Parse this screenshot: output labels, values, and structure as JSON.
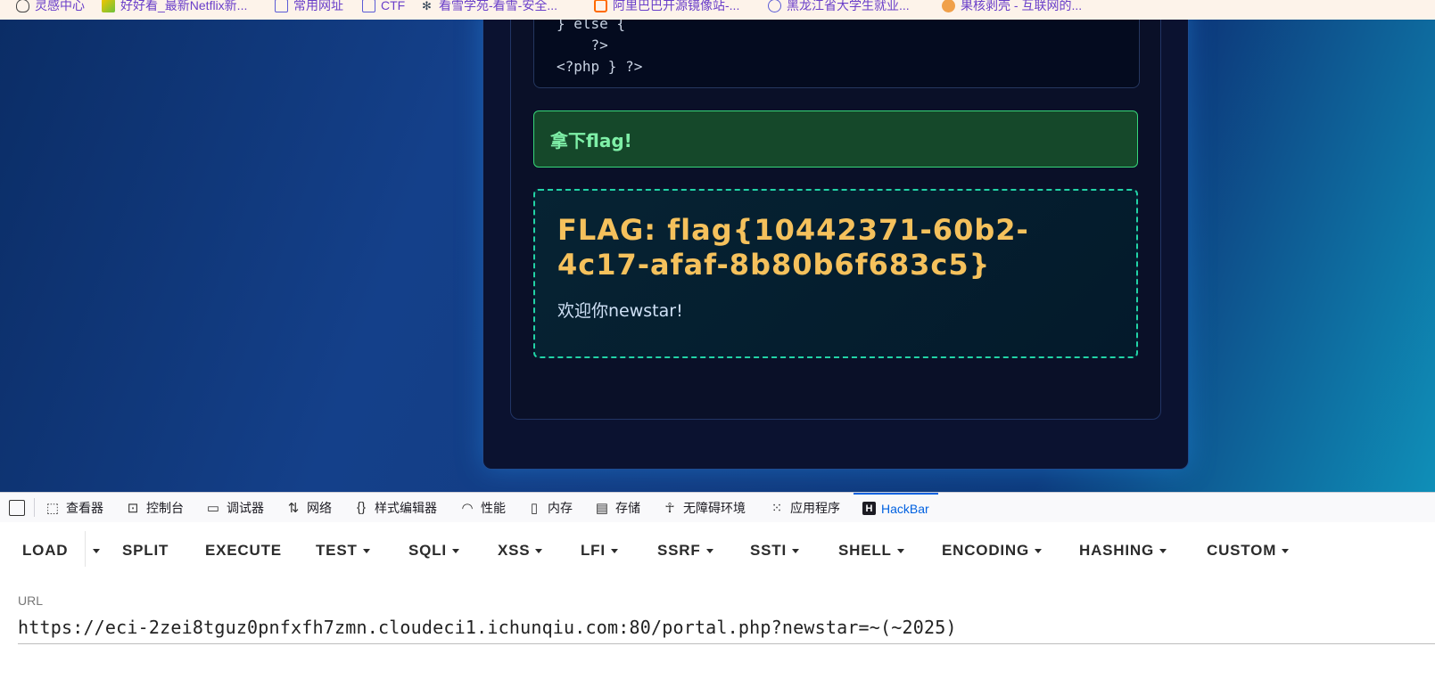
{
  "bookmarks": [
    {
      "label": "灵感中心",
      "icon": "bulb-icon"
    },
    {
      "label": "好好看_最新Netflix新...",
      "icon": "video-icon"
    },
    {
      "label": "常用网址",
      "icon": "folder-icon"
    },
    {
      "label": "CTF",
      "icon": "folder-icon"
    },
    {
      "label": "看雪学苑-看雪-安全...",
      "icon": "snowflake-icon"
    },
    {
      "label": "阿里巴巴开源镜像站-...",
      "icon": "alibaba-icon"
    },
    {
      "label": "黑龙江省大学生就业...",
      "icon": "globe-icon"
    },
    {
      "label": "果核剥壳 - 互联网的...",
      "icon": "nut-icon"
    }
  ],
  "page": {
    "code_lines": "} else {\n    ?>\n<?php } ?>",
    "success_message": "拿下flag!",
    "flag_text": "FLAG: flag{10442371-60b2-4c17-afaf-8b80b6f683c5}",
    "welcome_text": "欢迎你newstar!"
  },
  "devtools": {
    "tabs": [
      {
        "label": "查看器",
        "icon": "inspector-icon"
      },
      {
        "label": "控制台",
        "icon": "console-icon"
      },
      {
        "label": "调试器",
        "icon": "debugger-icon"
      },
      {
        "label": "网络",
        "icon": "network-icon"
      },
      {
        "label": "样式编辑器",
        "icon": "style-editor-icon"
      },
      {
        "label": "性能",
        "icon": "performance-icon"
      },
      {
        "label": "内存",
        "icon": "memory-icon"
      },
      {
        "label": "存储",
        "icon": "storage-icon"
      },
      {
        "label": "无障碍环境",
        "icon": "accessibility-icon"
      },
      {
        "label": "应用程序",
        "icon": "application-icon"
      },
      {
        "label": "HackBar",
        "icon": "hackbar-icon",
        "active": true
      }
    ]
  },
  "hackbar": {
    "buttons": [
      {
        "label": "LOAD",
        "dropdown": false
      },
      {
        "label": "SPLIT",
        "dropdown": false
      },
      {
        "label": "EXECUTE",
        "dropdown": false
      },
      {
        "label": "TEST",
        "dropdown": true
      },
      {
        "label": "SQLI",
        "dropdown": true
      },
      {
        "label": "XSS",
        "dropdown": true
      },
      {
        "label": "LFI",
        "dropdown": true
      },
      {
        "label": "SSRF",
        "dropdown": true
      },
      {
        "label": "SSTI",
        "dropdown": true
      },
      {
        "label": "SHELL",
        "dropdown": true
      },
      {
        "label": "ENCODING",
        "dropdown": true
      },
      {
        "label": "HASHING",
        "dropdown": true
      },
      {
        "label": "CUSTOM",
        "dropdown": true
      }
    ],
    "url_label": "URL",
    "url_value": "https://eci-2zei8tguz0pnfxfh7zmn.cloudeci1.ichunqiu.com:80/portal.php?newstar=~(~2025)"
  },
  "colors": {
    "flag": "#f5c15c",
    "success_text": "#7ff0a8",
    "active_tab": "#0061e0",
    "bookmark_text": "#6a3fc9"
  }
}
